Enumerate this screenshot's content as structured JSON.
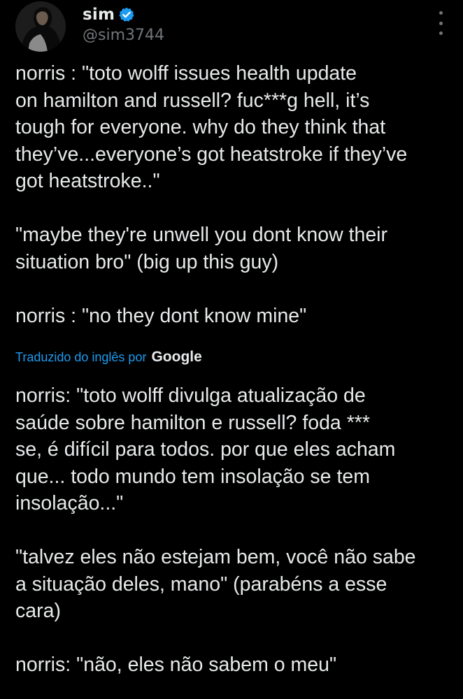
{
  "author": {
    "display_name": "sim",
    "handle": "@sim3744",
    "verified_icon": "verified-badge-icon",
    "verified_color": "#1d9bf0",
    "avatar_icon": "profile-avatar"
  },
  "menu": {
    "icon": "more-options-icon"
  },
  "tweet": {
    "text": "norris : \"toto wolff issues health update\non hamilton and russell? fuc***g hell, it’s\ntough for everyone. why do they think that\nthey’ve...everyone’s got heatstroke if they’ve\ngot heatstroke..\"\n\n\"maybe they're unwell you dont know their\nsituation bro\" (big up this guy)\n\nnorris : \"no they dont know mine\""
  },
  "translation": {
    "label": "Traduzido do inglês por",
    "provider": "Google",
    "label_color": "#1d9bf0",
    "text": "norris: \"toto wolff divulga atualização de\nsaúde sobre hamilton e russell? foda ***\nse, é difícil para todos. por que eles acham\nque... todo mundo tem insolação se tem\ninsolação...\"\n\n\"talvez eles não estejam bem, você não sabe\na situação deles, mano\" (parabéns a esse\ncara)\n\nnorris: \"não, eles não sabem o meu\""
  },
  "colors": {
    "background": "#000000",
    "text": "#e7e9ea",
    "muted": "#71767b"
  }
}
